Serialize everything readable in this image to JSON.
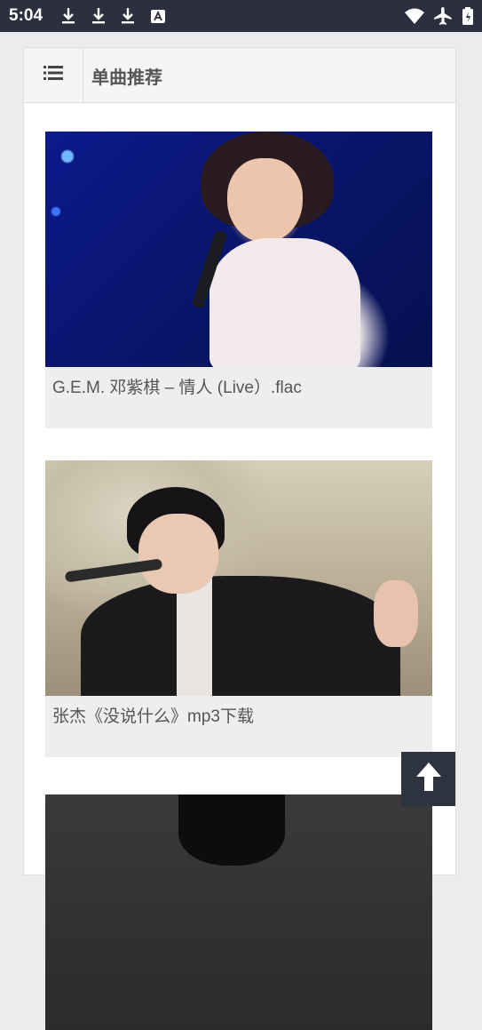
{
  "status_bar": {
    "time": "5:04",
    "left_icons": [
      "download-icon",
      "download-icon",
      "download-icon",
      "accessibility-a-icon"
    ],
    "right_icons": [
      "wifi-icon",
      "airplane-icon",
      "battery-icon"
    ]
  },
  "header": {
    "menu_icon": "list-icon",
    "title": "单曲推荐"
  },
  "items": [
    {
      "caption": "G.E.M. 邓紫棋 – 情人 (Live）.flac"
    },
    {
      "caption": "张杰《没说什么》mp3下载"
    },
    {
      "caption": ""
    }
  ],
  "back_to_top_icon": "arrow-up-icon",
  "colors": {
    "status_bar_bg": "#2c2f3e",
    "back_to_top_bg": "#2d3440",
    "caption_bg": "#eeeeee"
  }
}
